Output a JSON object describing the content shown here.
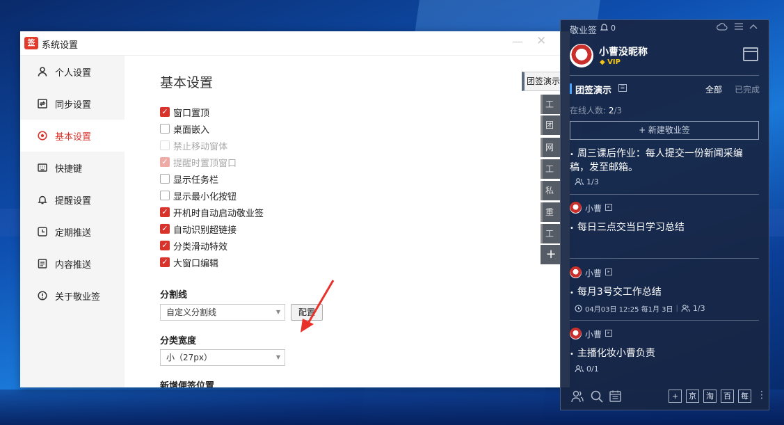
{
  "settings_window": {
    "title": "系统设置",
    "min_glyph": "—",
    "close_glyph": "✕",
    "sidebar": [
      {
        "label": "个人设置",
        "icon": "person-icon",
        "active": false
      },
      {
        "label": "同步设置",
        "icon": "sync-icon",
        "active": false
      },
      {
        "label": "基本设置",
        "icon": "target-icon",
        "active": true
      },
      {
        "label": "快捷键",
        "icon": "keyboard-icon",
        "active": false
      },
      {
        "label": "提醒设置",
        "icon": "bell-icon",
        "active": false
      },
      {
        "label": "定期推送",
        "icon": "clock-icon",
        "active": false
      },
      {
        "label": "内容推送",
        "icon": "document-icon",
        "active": false
      },
      {
        "label": "关于敬业签",
        "icon": "info-icon",
        "active": false
      }
    ],
    "page_title": "基本设置",
    "options": [
      {
        "label": "窗口置顶",
        "checked": true,
        "disabled": false
      },
      {
        "label": "桌面嵌入",
        "checked": false,
        "disabled": false
      },
      {
        "label": "禁止移动窗体",
        "checked": false,
        "disabled": true
      },
      {
        "label": "提醒时置顶窗口",
        "checked": true,
        "disabled": true
      },
      {
        "label": "显示任务栏",
        "checked": false,
        "disabled": false
      },
      {
        "label": "显示最小化按钮",
        "checked": false,
        "disabled": false
      },
      {
        "label": "开机时自动启动敬业签",
        "checked": true,
        "disabled": false
      },
      {
        "label": "自动识别超链接",
        "checked": true,
        "disabled": false
      },
      {
        "label": "分类滑动特效",
        "checked": true,
        "disabled": false
      },
      {
        "label": "大窗口编辑",
        "checked": true,
        "disabled": false
      }
    ],
    "divider": {
      "label": "分割线",
      "value": "自定义分割线",
      "button": "配置"
    },
    "category_width": {
      "label": "分类宽度",
      "value": "小（27px）"
    },
    "new_note_position": {
      "label": "新增便签位置"
    }
  },
  "side_tabs": {
    "main": "团签演示",
    "items": [
      "工作",
      "团签",
      "网络",
      "工作",
      "私密",
      "重要",
      "工作"
    ],
    "add": "+"
  },
  "notes_panel": {
    "brand": "敬业签",
    "notification_count": "0",
    "user": {
      "name": "小曹没昵称",
      "badge": "VIP"
    },
    "group": {
      "title": "团签演示",
      "filter_all": "全部",
      "filter_done": "已完成"
    },
    "online": {
      "label": "在线人数:",
      "current": "2",
      "total": "/3"
    },
    "new_button": "+ 新建敬业签",
    "notes": [
      {
        "text": "周三课后作业：每人提交一份新闻采编稿，发至邮箱。",
        "assignees": "1/3"
      },
      {
        "author": "小曹",
        "text": "每日三点交当日学习总结"
      },
      {
        "author": "小曹",
        "text": "每月3号交工作总结",
        "date": "04月03日 12:25 每1月 3日",
        "assignees": "1/3"
      },
      {
        "author": "小曹",
        "text": "主播化妆小曹负责",
        "assignees": "0/1"
      }
    ],
    "bottom_shortcuts": [
      "京",
      "淘",
      "百",
      "每"
    ]
  },
  "colors": {
    "accent_red": "#d9342b",
    "panel_bg": "#18263f",
    "highlight_blue": "#4aa3ff"
  }
}
